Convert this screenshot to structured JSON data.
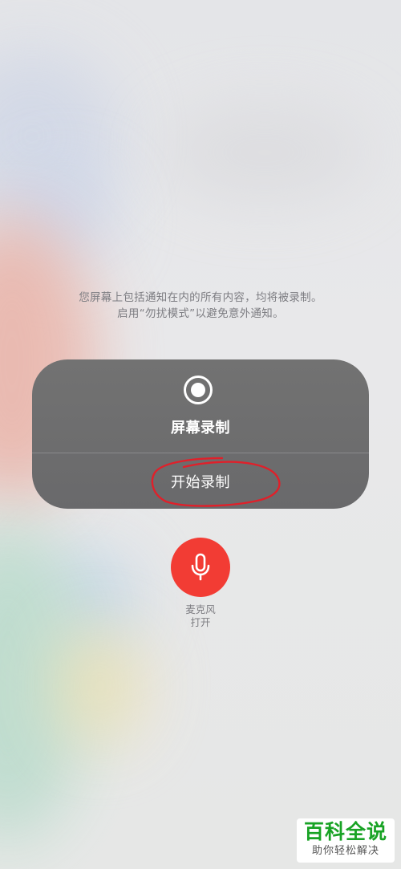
{
  "notice": {
    "line1": "您屏幕上包括通知在内的所有内容，均将被录制。",
    "line2": "启用“勿扰模式”以避免意外通知。"
  },
  "recording_card": {
    "icon": "record-icon",
    "title": "屏幕录制",
    "start_button_label": "开始录制"
  },
  "microphone": {
    "icon": "microphone-icon",
    "label_line1": "麦克风",
    "label_line2": "打开",
    "color": "#f23c34"
  },
  "watermark": {
    "title": "百科全说",
    "subtitle": "助你轻松解决",
    "color": "#19a325"
  },
  "annotation": {
    "color": "#e0202a"
  }
}
